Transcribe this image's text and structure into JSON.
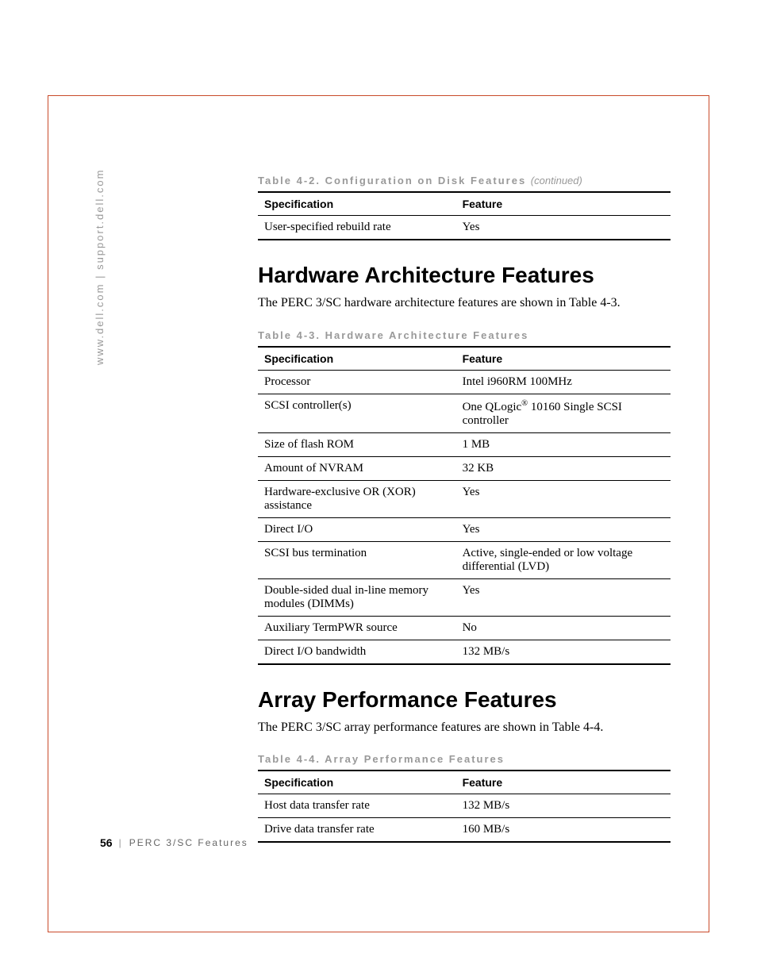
{
  "side_url": "www.dell.com | support.dell.com",
  "table42": {
    "caption": "Table 4-2. Configuration on Disk Features ",
    "continued": "(continued)",
    "headers": {
      "spec": "Specification",
      "feat": "Feature"
    },
    "rows": [
      {
        "spec": "User-specified rebuild rate",
        "feat": "Yes"
      }
    ]
  },
  "section1": {
    "heading": "Hardware Architecture Features",
    "intro": "The PERC 3/SC hardware architecture features are shown in Table 4-3."
  },
  "table43": {
    "caption": "Table 4-3. Hardware Architecture Features",
    "headers": {
      "spec": "Specification",
      "feat": "Feature"
    },
    "rows": [
      {
        "spec": "Processor",
        "feat": "Intel i960RM 100MHz"
      },
      {
        "spec": "SCSI controller(s)",
        "feat_pre": "One QLogic",
        "feat_sup": "®",
        "feat_post": " 10160 Single SCSI controller"
      },
      {
        "spec": "Size of flash ROM",
        "feat": "1 MB"
      },
      {
        "spec": "Amount of NVRAM",
        "feat": "32 KB"
      },
      {
        "spec": "Hardware-exclusive OR (XOR) assistance",
        "feat": "Yes"
      },
      {
        "spec": "Direct I/O",
        "feat": "Yes"
      },
      {
        "spec": "SCSI bus termination",
        "feat": "Active, single-ended or low voltage differential (LVD)"
      },
      {
        "spec": "Double-sided dual in-line memory modules (DIMMs)",
        "feat": "Yes"
      },
      {
        "spec": "Auxiliary TermPWR source",
        "feat": "No"
      },
      {
        "spec": "Direct I/O bandwidth",
        "feat": "132 MB/s"
      }
    ]
  },
  "section2": {
    "heading": "Array Performance Features",
    "intro": "The PERC 3/SC array performance features are shown in Table 4-4."
  },
  "table44": {
    "caption": "Table 4-4. Array Performance Features",
    "headers": {
      "spec": "Specification",
      "feat": "Feature"
    },
    "rows": [
      {
        "spec": "Host data transfer rate",
        "feat": "132 MB/s"
      },
      {
        "spec": "Drive data transfer rate",
        "feat": "160 MB/s"
      }
    ]
  },
  "footer": {
    "page": "56",
    "chapter": "PERC 3/SC Features"
  }
}
